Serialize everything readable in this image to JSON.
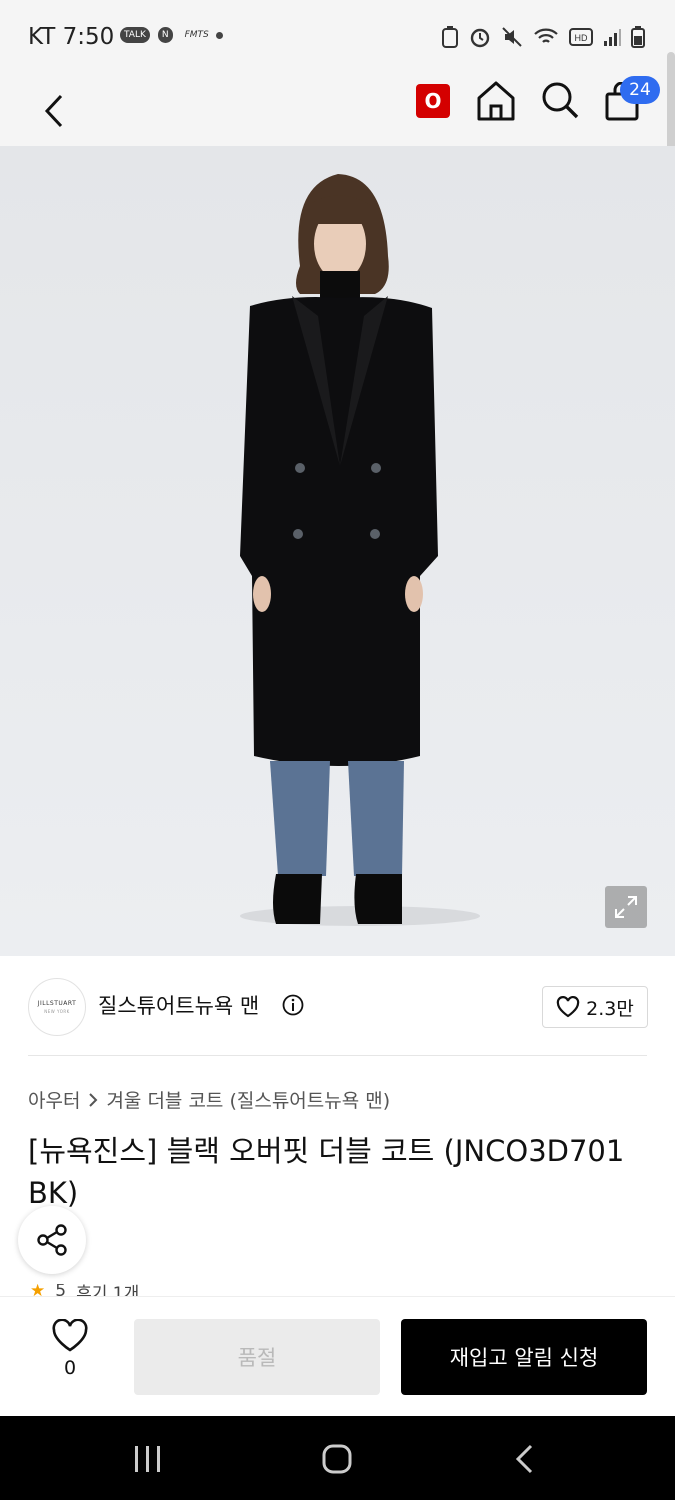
{
  "status_bar": {
    "time": "KT 7:50",
    "apps": [
      "TALK",
      "N",
      "FMTS"
    ],
    "right_icons": [
      "☗",
      "⏰",
      "🔇",
      "wifi",
      "HD",
      "signal",
      "battery"
    ]
  },
  "app_bar": {
    "badge_label": "O",
    "cart_count": "24"
  },
  "image": {
    "alt": "model wearing black overfit double coat"
  },
  "brand": {
    "logo_text": "JILLSTUART",
    "logo_sub": "NEW YORK",
    "name": "질스튜어트뉴욕 맨",
    "like_count": "2.3만"
  },
  "breadcrumb": {
    "level1": "아우터",
    "level2": "겨울 더블 코트 (질스튜어트뉴욕 맨)"
  },
  "product": {
    "title": "[뉴욕진스] 블랙 오버핏 더블 코트 (JNCO3D701 BK)"
  },
  "rating": {
    "star": "★",
    "score": "5",
    "reviews": "후기 1개"
  },
  "bottom_bar": {
    "wish_count": "0",
    "soldout_label": "품절",
    "restock_label": "재입고 알림 신청"
  }
}
